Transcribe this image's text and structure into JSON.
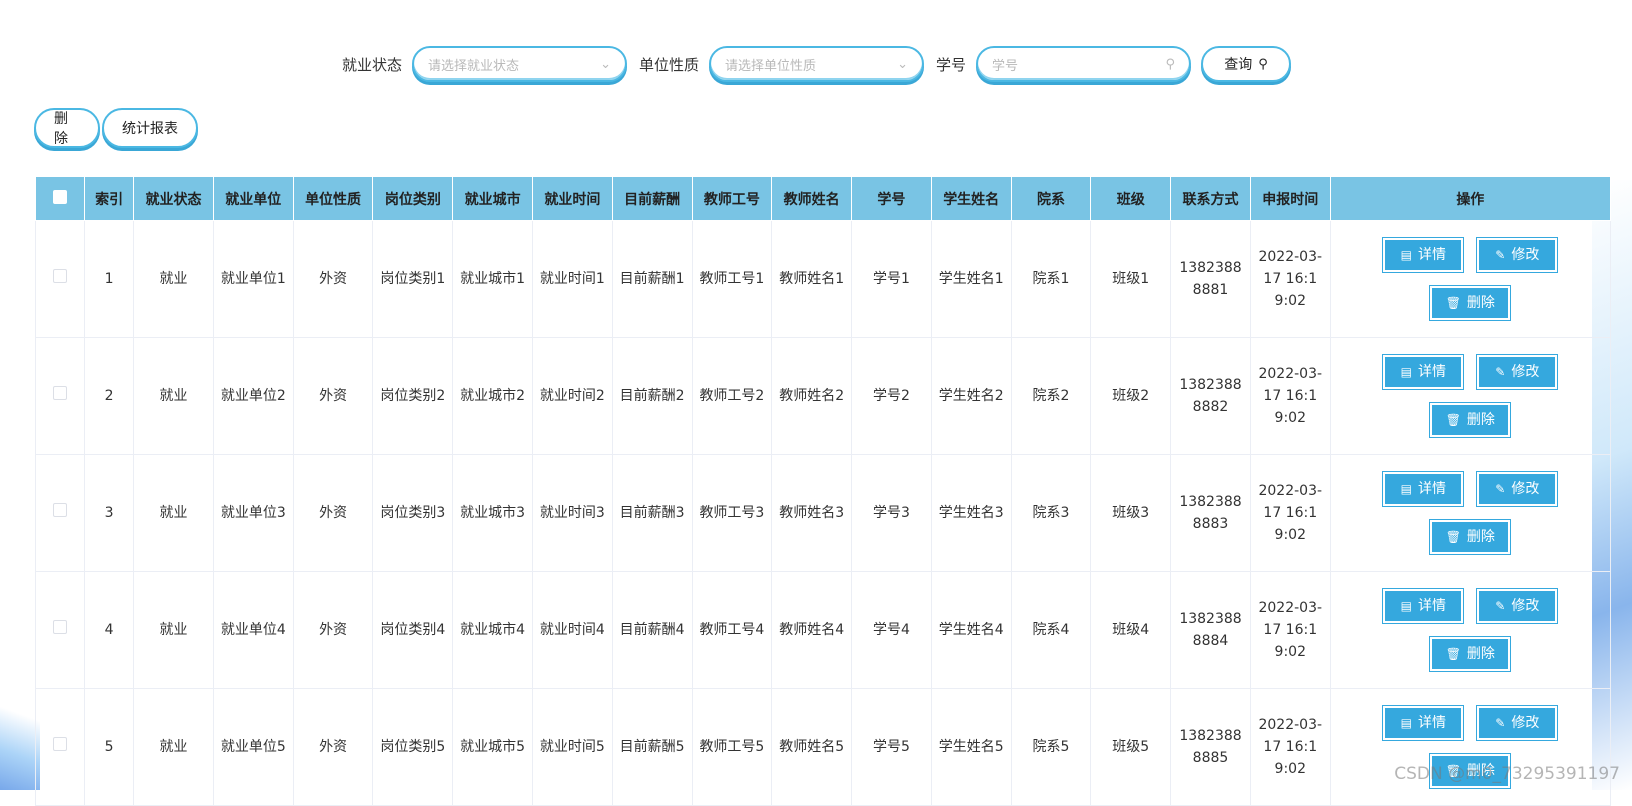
{
  "search": {
    "status_label": "就业状态",
    "status_placeholder": "请选择就业状态",
    "nature_label": "单位性质",
    "nature_placeholder": "请选择单位性质",
    "student_no_label": "学号",
    "student_no_placeholder": "学号",
    "query_label": "查询"
  },
  "toolbar": {
    "delete_label": "删除",
    "report_label": "统计报表"
  },
  "table": {
    "columns": [
      "索引",
      "就业状态",
      "就业单位",
      "单位性质",
      "岗位类别",
      "就业城市",
      "就业时间",
      "目前薪酬",
      "教师工号",
      "教师姓名",
      "学号",
      "学生姓名",
      "院系",
      "班级",
      "联系方式",
      "申报时间",
      "操作"
    ],
    "rows": [
      {
        "index": "1",
        "status": "就业",
        "company": "就业单位1",
        "nature": "外资",
        "category": "岗位类别1",
        "city": "就业城市1",
        "time": "就业时间1",
        "salary": "目前薪酬1",
        "teacher_no": "教师工号1",
        "teacher_name": "教师姓名1",
        "student_no": "学号1",
        "student_name": "学生姓名1",
        "dept": "院系1",
        "class": "班级1",
        "phone": "13823888881",
        "date": "2022-03-17 16:19:02"
      },
      {
        "index": "2",
        "status": "就业",
        "company": "就业单位2",
        "nature": "外资",
        "category": "岗位类别2",
        "city": "就业城市2",
        "time": "就业时间2",
        "salary": "目前薪酬2",
        "teacher_no": "教师工号2",
        "teacher_name": "教师姓名2",
        "student_no": "学号2",
        "student_name": "学生姓名2",
        "dept": "院系2",
        "class": "班级2",
        "phone": "13823888882",
        "date": "2022-03-17 16:19:02"
      },
      {
        "index": "3",
        "status": "就业",
        "company": "就业单位3",
        "nature": "外资",
        "category": "岗位类别3",
        "city": "就业城市3",
        "time": "就业时间3",
        "salary": "目前薪酬3",
        "teacher_no": "教师工号3",
        "teacher_name": "教师姓名3",
        "student_no": "学号3",
        "student_name": "学生姓名3",
        "dept": "院系3",
        "class": "班级3",
        "phone": "13823888883",
        "date": "2022-03-17 16:19:02"
      },
      {
        "index": "4",
        "status": "就业",
        "company": "就业单位4",
        "nature": "外资",
        "category": "岗位类别4",
        "city": "就业城市4",
        "time": "就业时间4",
        "salary": "目前薪酬4",
        "teacher_no": "教师工号4",
        "teacher_name": "教师姓名4",
        "student_no": "学号4",
        "student_name": "学生姓名4",
        "dept": "院系4",
        "class": "班级4",
        "phone": "13823888884",
        "date": "2022-03-17 16:19:02"
      },
      {
        "index": "5",
        "status": "就业",
        "company": "就业单位5",
        "nature": "外资",
        "category": "岗位类别5",
        "city": "就业城市5",
        "time": "就业时间5",
        "salary": "目前薪酬5",
        "teacher_no": "教师工号5",
        "teacher_name": "教师姓名5",
        "student_no": "学号5",
        "student_name": "学生姓名5",
        "dept": "院系5",
        "class": "班级5",
        "phone": "13823888885",
        "date": "2022-03-17 16:19:02"
      }
    ],
    "row_actions": {
      "detail": "详情",
      "edit": "修改",
      "delete": "删除"
    }
  },
  "icons": {
    "dropdown": "chevron-down-icon",
    "search": "search-icon",
    "detail": "document-icon",
    "edit": "edit-icon",
    "delete": "trash-icon"
  },
  "colors": {
    "accent": "#35a8de",
    "header_bg": "#79c4e4",
    "pill_border": "#4bb8e3"
  },
  "watermark": "CSDN @m0_73295391197"
}
